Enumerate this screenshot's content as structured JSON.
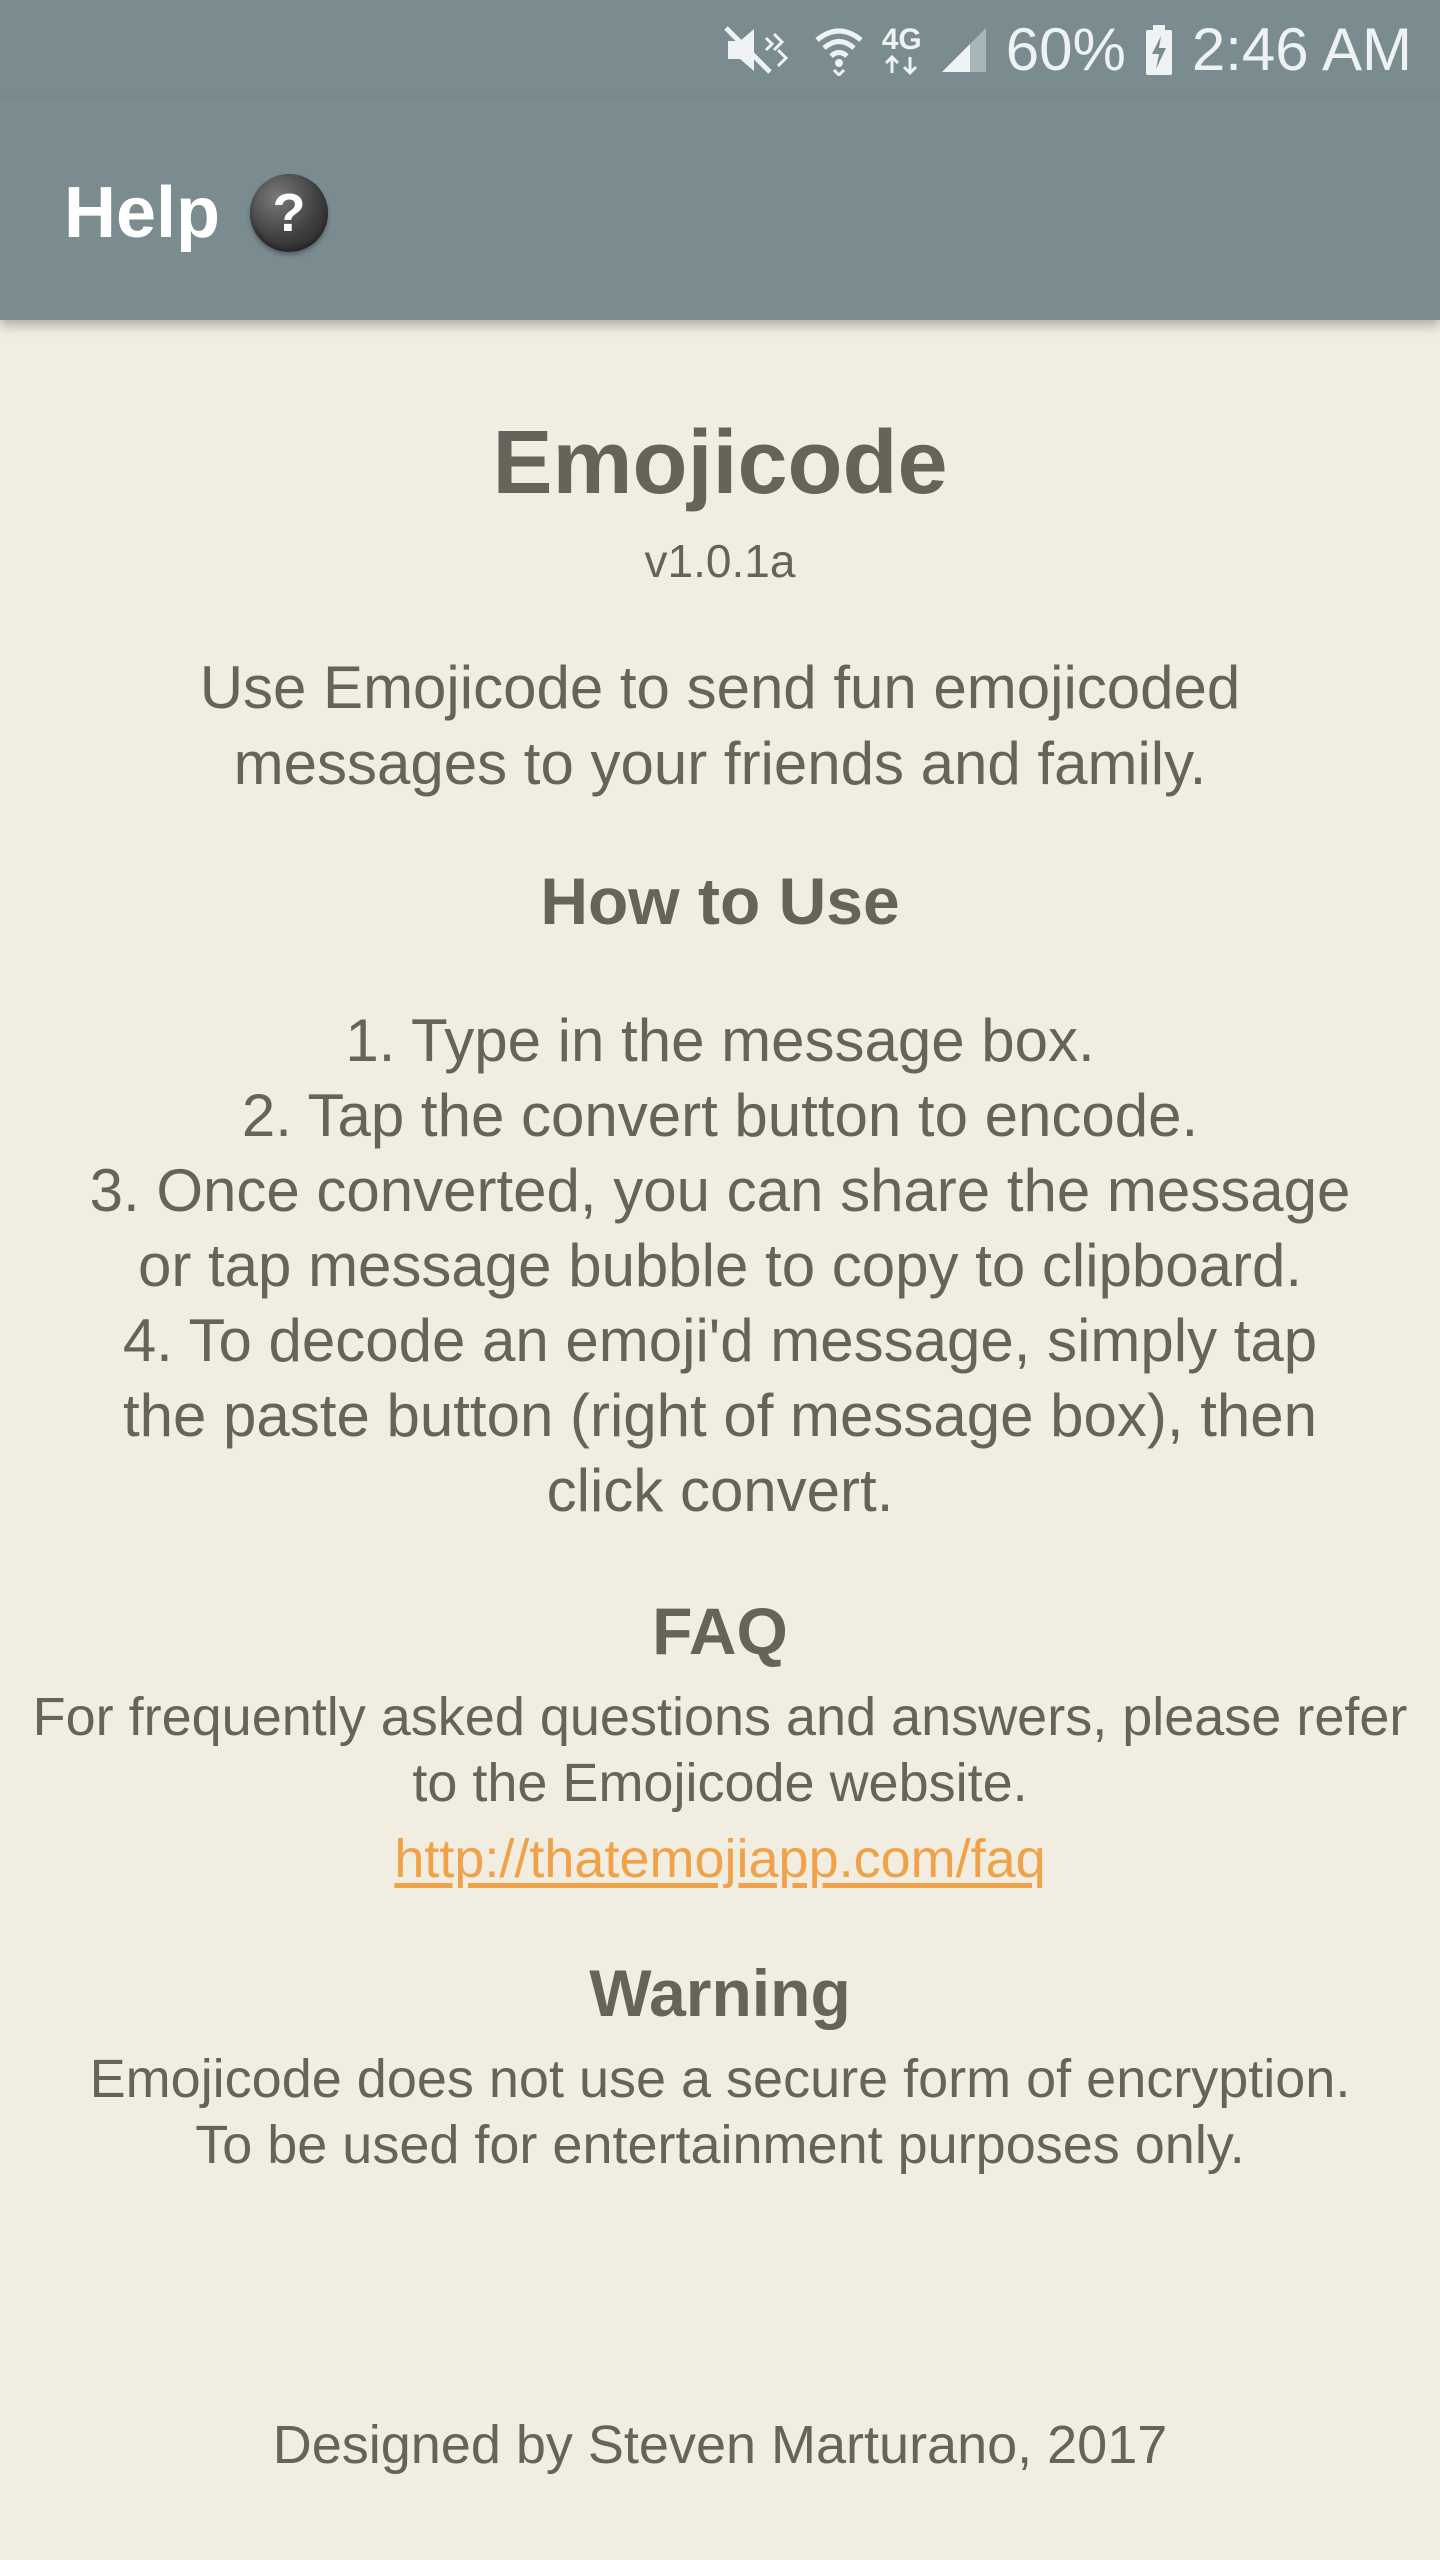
{
  "status_bar": {
    "battery": "60%",
    "time": "2:46 AM",
    "network": "4G",
    "icons": [
      "mute-icon",
      "wifi-icon",
      "4g-lte-icon",
      "signal-icon",
      "battery-charging-icon"
    ]
  },
  "app_bar": {
    "title": "Help",
    "help_icon_glyph": "?"
  },
  "about": {
    "app_name": "Emojicode",
    "version": "v1.0.1a",
    "intro_lines": [
      "Use Emojicode to send fun emojicoded",
      "messages to your friends and family."
    ]
  },
  "how_to_use": {
    "heading": "How to Use",
    "lines": [
      "1. Type in the message box.",
      "2. Tap the convert button to encode.",
      "3. Once converted, you can share the message",
      "or tap message bubble to copy to clipboard.",
      "4. To decode an emoji'd message, simply tap",
      "the paste button (right of message box), then",
      "click convert."
    ]
  },
  "faq": {
    "heading": "FAQ",
    "lines": [
      "For frequently asked questions and answers, please refer",
      "to the Emojicode website."
    ],
    "link": "http://thatemojiapp.com/faq"
  },
  "warning": {
    "heading": "Warning",
    "lines": [
      "Emojicode does not use a secure form of encryption.",
      "To be used for entertainment purposes only."
    ]
  },
  "footer": {
    "credit": "Designed by Steven Marturano, 2017"
  },
  "colors": {
    "app_bar": "#7a8c90",
    "background": "#f1ede0",
    "text": "#66645a",
    "link": "#f0a24a"
  }
}
